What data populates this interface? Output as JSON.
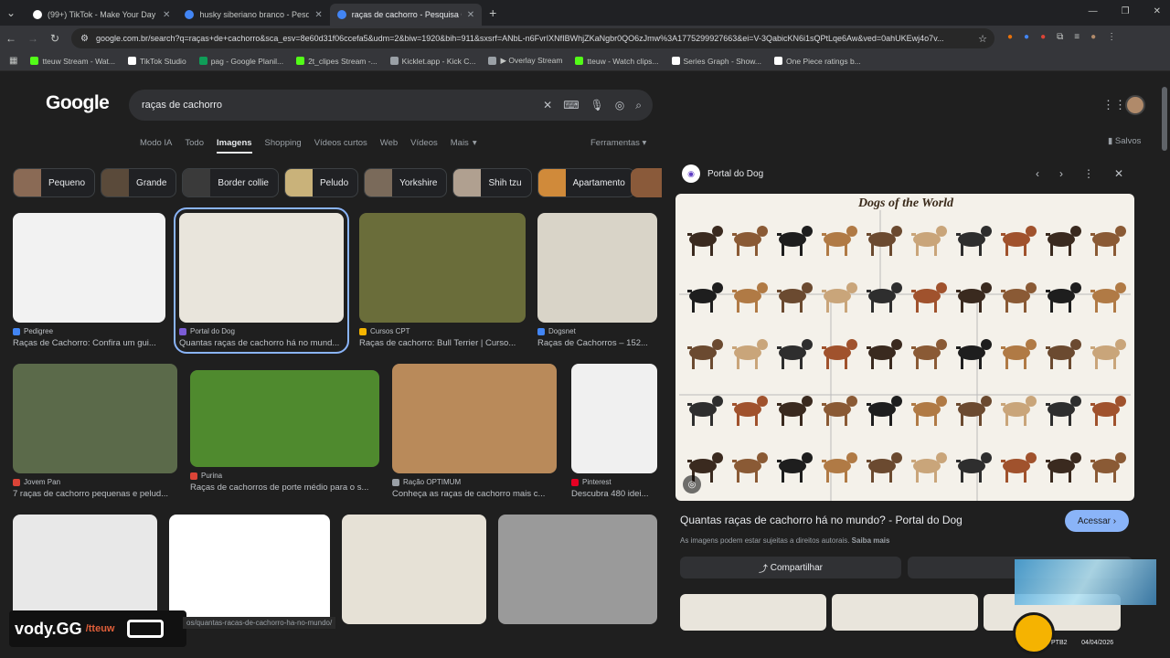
{
  "tabs": [
    {
      "title": "(99+) TikTok - Make Your Day",
      "active": false,
      "color": "#ffffff"
    },
    {
      "title": "husky siberiano branco - Pesqu...",
      "active": false,
      "color": "#4285f4"
    },
    {
      "title": "raças de cachorro - Pesquisa G...",
      "active": true,
      "color": "#4285f4"
    }
  ],
  "url": "google.com.br/search?q=raças+de+cachorro&sca_esv=8e60d31f06ccefa5&udm=2&biw=1920&bih=911&sxsrf=ANbL-n6FvrIXNfIBWhjZKaNgbr0QO6zJmw%3A1775299927663&ei=V-3QabicKN6i1sQPtLqe6Aw&ved=0ahUKEwj4o7v...",
  "bookmarks": [
    {
      "label": "tteuw Stream - Wat...",
      "color": "#53fc18"
    },
    {
      "label": "TikTok Studio",
      "color": "#ffffff"
    },
    {
      "label": "pag - Google Planil...",
      "color": "#0f9d58"
    },
    {
      "label": "2t_clipes Stream -...",
      "color": "#53fc18"
    },
    {
      "label": "Kicklet.app - Kick C...",
      "color": "#9aa0a6"
    },
    {
      "label": "▶ Overlay Stream",
      "color": "#9aa0a6"
    },
    {
      "label": "tteuw - Watch clips...",
      "color": "#53fc18"
    },
    {
      "label": "Series Graph - Show...",
      "color": "#ffffff"
    },
    {
      "label": "One Piece ratings b...",
      "color": "#ffffff"
    }
  ],
  "google": {
    "logo": "Google",
    "query": "raças de cachorro",
    "modes": [
      "Modo IA",
      "Todo",
      "Imagens",
      "Shopping",
      "Vídeos curtos",
      "Web",
      "Vídeos",
      "Mais"
    ],
    "active_mode": "Imagens",
    "tools": "Ferramentas",
    "saved": "Salvos"
  },
  "chips": [
    {
      "label": "Pequeno",
      "color": "#8a6a55"
    },
    {
      "label": "Grande",
      "color": "#5a4a3a"
    },
    {
      "label": "Border collie",
      "color": "#3a3a3a"
    },
    {
      "label": "Peludo",
      "color": "#c9b27a"
    },
    {
      "label": "Yorkshire",
      "color": "#7a6a5a"
    },
    {
      "label": "Shih tzu",
      "color": "#b0a090"
    },
    {
      "label": "Apartamento",
      "color": "#d08a3a"
    }
  ],
  "results": [
    {
      "source": "Pedigree",
      "caption": "Raças de Cachorro: Confira um gui...",
      "color": "#f2f2f2",
      "icon": "#4285f4"
    },
    {
      "source": "Portal do Dog",
      "caption": "Quantas raças de cachorro há no mund...",
      "color": "#e9e5dc",
      "icon": "#7b5cd6"
    },
    {
      "source": "Cursos CPT",
      "caption": "Raças de cachorro: Bull Terrier | Curso...",
      "color": "#6a6d3a",
      "icon": "#f4b400"
    },
    {
      "source": "Dogsnet",
      "caption": "Raças de Cachorros – 152...",
      "color": "#d9d4c8",
      "icon": "#4285f4"
    },
    {
      "source": "Jovem Pan",
      "caption": "7 raças de cachorro pequenas e pelud...",
      "color": "#5b6a4a",
      "icon": "#db4437"
    },
    {
      "source": "Purina",
      "caption": "Raças de cachorros de porte médio para o s...",
      "color": "#4f8a2e",
      "icon": "#db4437"
    },
    {
      "source": "Ração OPTIMUM",
      "caption": "Conheça as raças de cachorro mais c...",
      "color": "#b98a5a",
      "icon": "#9aa0a6"
    },
    {
      "source": "Pinterest",
      "caption": "Descubra 480 idei...",
      "color": "#f0f0f0",
      "icon": "#e60023"
    }
  ],
  "panel": {
    "site": "Portal do Dog",
    "preview_title": "Dogs of the World",
    "title": "Quantas raças de cachorro há no mundo? - Portal do Dog",
    "visit": "Acessar",
    "rights": "As imagens podem estar sujeitas a direitos autorais.",
    "rights_more": "Saiba mais",
    "share": "Compartilhar"
  },
  "overlay": {
    "brand": "vody.GG",
    "channel": "/tteuw"
  },
  "status_url": "os/quantas-racas-de-cachorro-ha-no-mundo/",
  "taskbar": {
    "lang": "PTB2",
    "date": "04/04/2026"
  }
}
